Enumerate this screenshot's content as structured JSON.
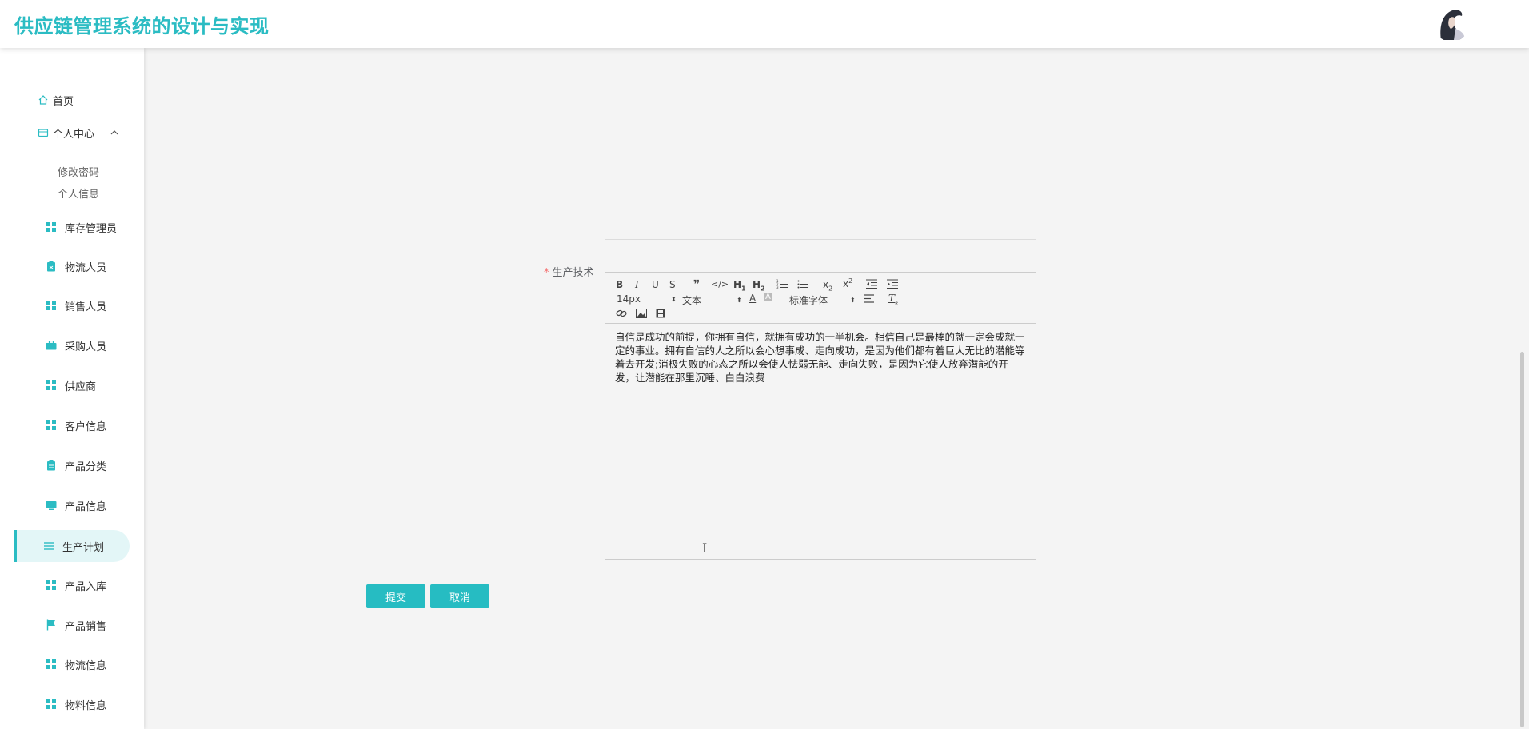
{
  "header": {
    "title": "供应链管理系统的设计与实现"
  },
  "sidebar": {
    "home": "首页",
    "personal_center": "个人中心",
    "personal_sub": [
      "修改密码",
      "个人信息"
    ],
    "items": [
      {
        "label": "库存管理员",
        "icon": "grid-icon"
      },
      {
        "label": "物流人员",
        "icon": "clipboard-icon"
      },
      {
        "label": "销售人员",
        "icon": "grid-icon"
      },
      {
        "label": "采购人员",
        "icon": "briefcase-icon"
      },
      {
        "label": "供应商",
        "icon": "grid-icon"
      },
      {
        "label": "客户信息",
        "icon": "grid-icon"
      },
      {
        "label": "产品分类",
        "icon": "clipboard-icon"
      },
      {
        "label": "产品信息",
        "icon": "monitor-icon"
      },
      {
        "label": "生产计划",
        "icon": "list-icon",
        "active": true
      },
      {
        "label": "产品入库",
        "icon": "grid-icon"
      },
      {
        "label": "产品销售",
        "icon": "flag-icon"
      },
      {
        "label": "物流信息",
        "icon": "grid-icon"
      },
      {
        "label": "物料信息",
        "icon": "grid-icon"
      }
    ]
  },
  "form": {
    "field_label": "生产技术",
    "required_mark": "*",
    "editor": {
      "size_picker": "14px",
      "header_picker": "文本",
      "font_picker": "标准字体",
      "content": "自信是成功的前提，你拥有自信，就拥有成功的一半机会。相信自己是最棒的就一定会成就一定的事业。拥有自信的人之所以会心想事成、走向成功，是因为他们都有着巨大无比的潜能等着去开发;消极失败的心态之所以会使人怯弱无能、走向失败，是因为它使人放弃潜能的开发，让潜能在那里沉睡、白白浪费"
    },
    "submit_label": "提交",
    "cancel_label": "取消"
  },
  "colors": {
    "accent": "#2bbcc3",
    "active_bg": "#e3f6f7",
    "button": "#26bcc2"
  }
}
